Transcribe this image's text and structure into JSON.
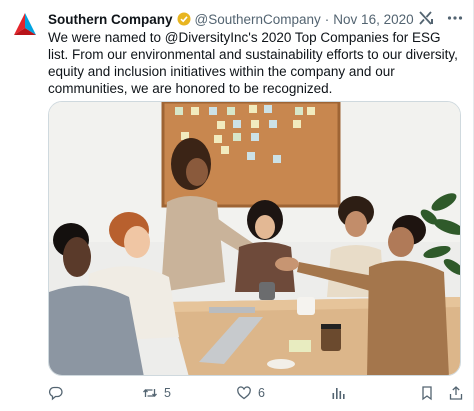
{
  "tweet": {
    "author_name": "Southern Company",
    "handle": "@SouthernCompany",
    "separator": "·",
    "date": "Nov 16, 2020",
    "text": "We were named to @DiversityInc's 2020 Top Companies for ESG list. From our environmental and sustainability efforts to our diversity, equity and inclusion initiatives within the company and our communities, we are honored to be recognized.",
    "image_alt": "Team meeting around a wooden table with a handshake"
  },
  "actions": {
    "reply_count": "",
    "retweet_count": "5",
    "like_count": "6",
    "views_count": ""
  },
  "icons": [
    "company-logo-icon",
    "verified-badge-icon",
    "grok-icon",
    "more-icon",
    "reply-icon",
    "retweet-icon",
    "like-icon",
    "views-icon",
    "bookmark-icon",
    "share-icon"
  ],
  "colors": {
    "text": "#0f1419",
    "secondary": "#536471",
    "verified": "#e8b520",
    "logo_red": "#e4262b",
    "logo_blue": "#00a3e0"
  }
}
